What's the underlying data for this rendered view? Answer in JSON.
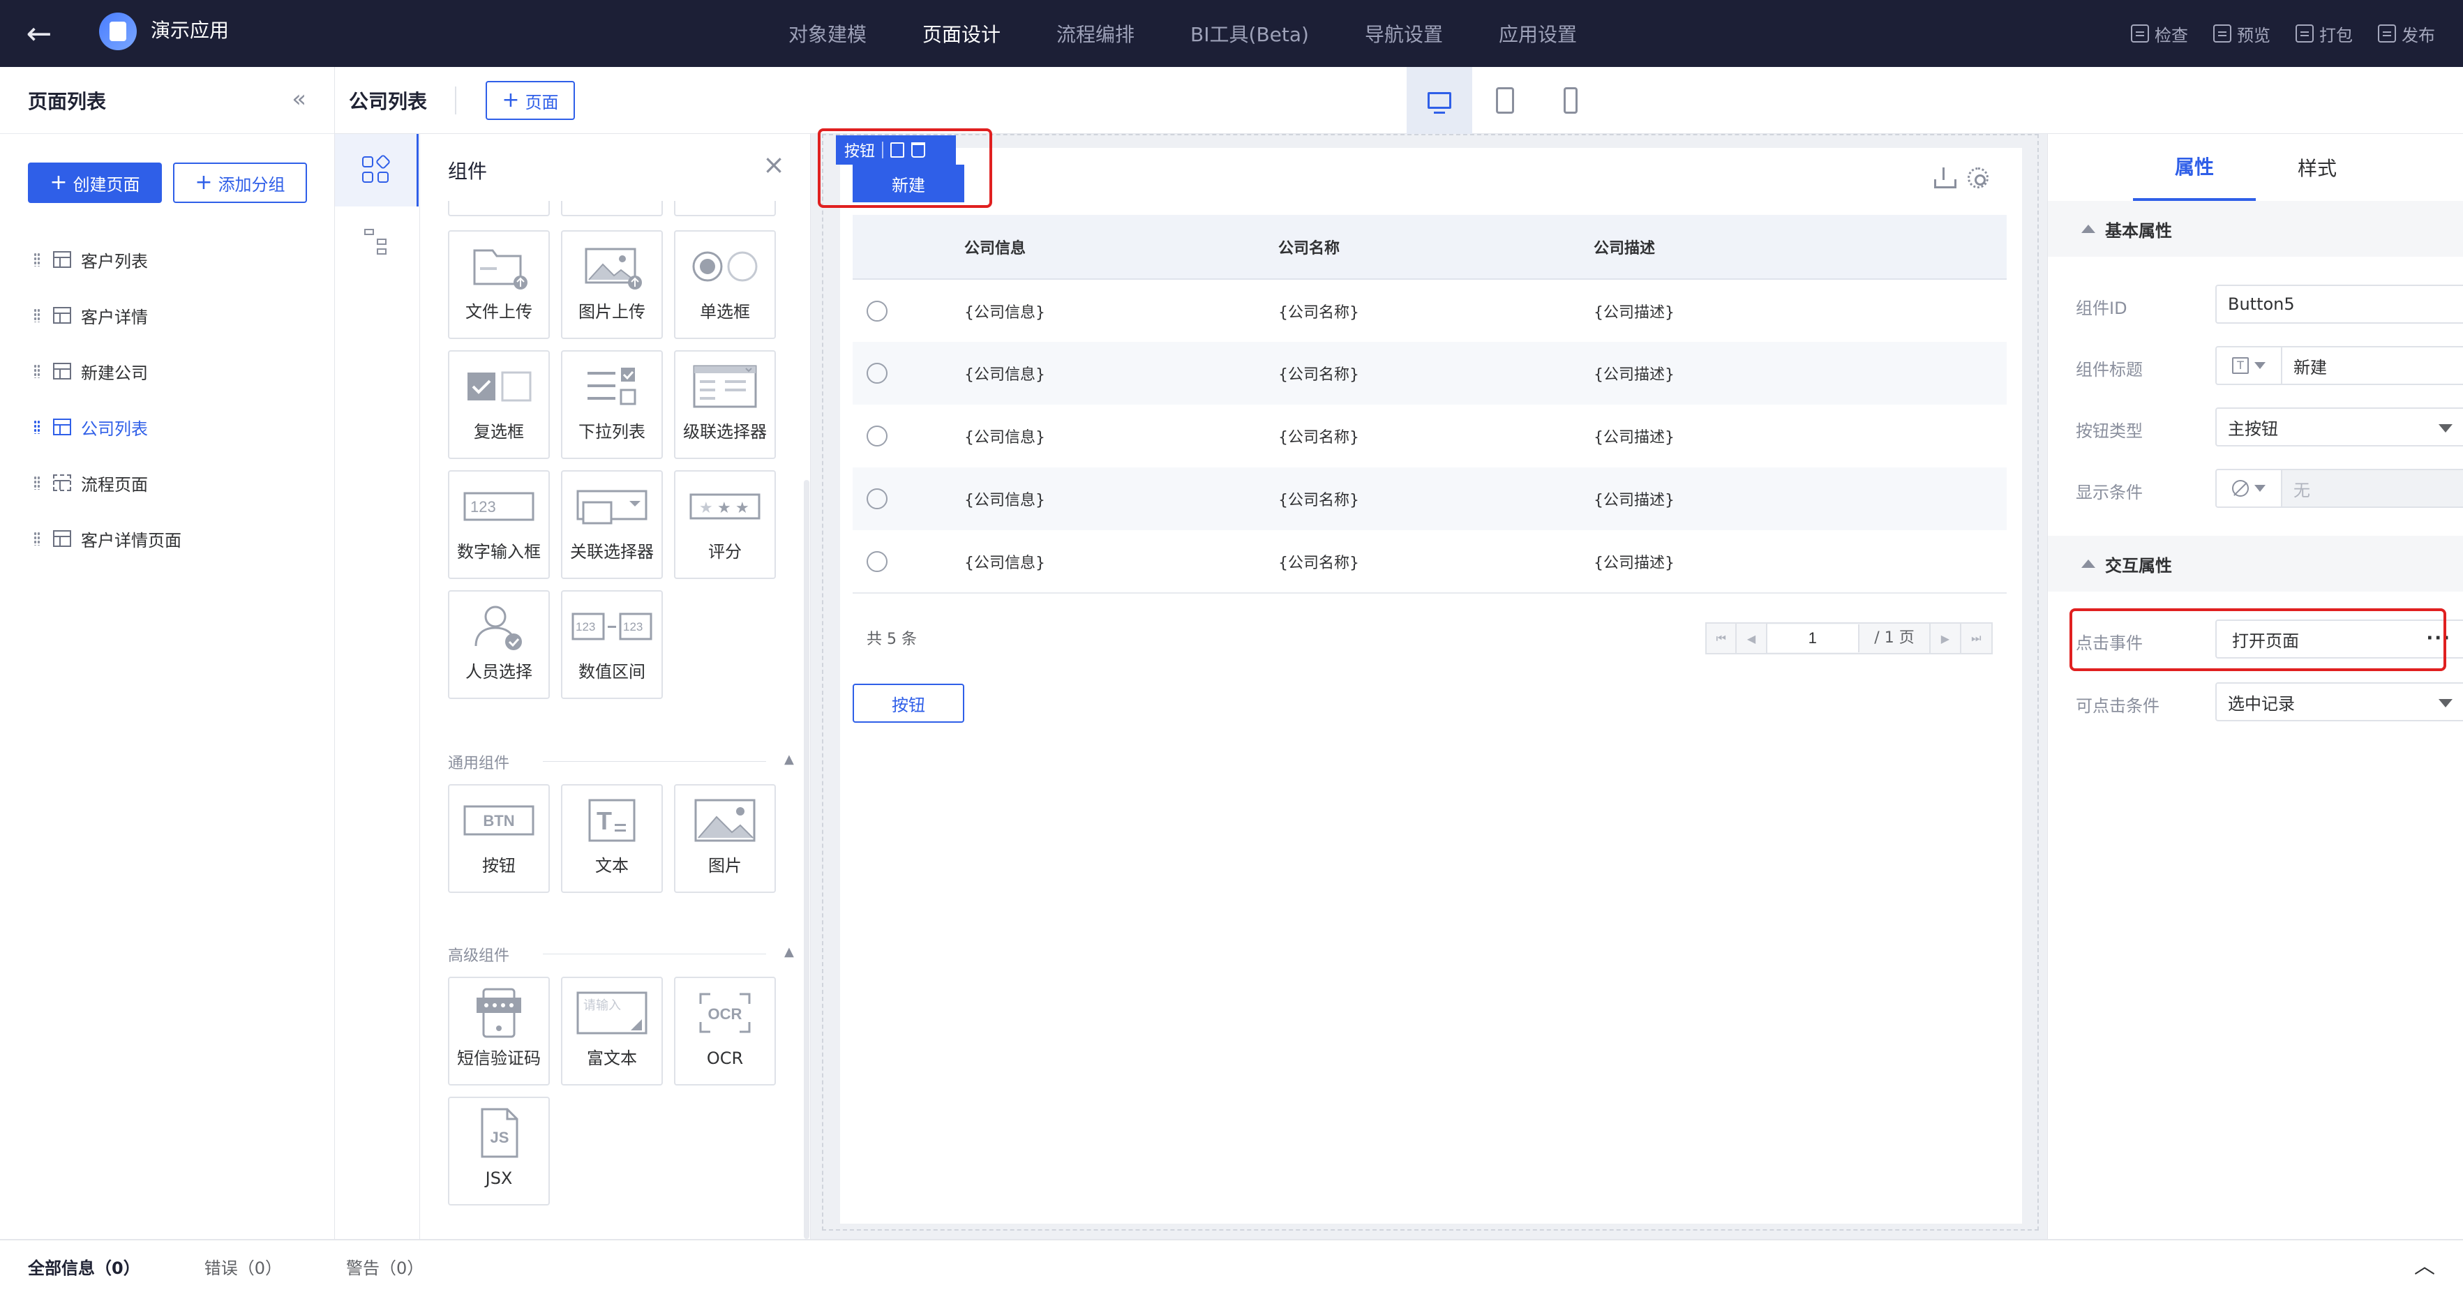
{
  "topbar": {
    "app_name": "演示应用",
    "tabs": [
      {
        "label": "对象建模",
        "active": false
      },
      {
        "label": "页面设计",
        "active": true
      },
      {
        "label": "流程编排",
        "active": false
      },
      {
        "label": "BI工具(Beta)",
        "active": false
      },
      {
        "label": "导航设置",
        "active": false
      },
      {
        "label": "应用设置",
        "active": false
      }
    ],
    "tools": [
      "检查",
      "预览",
      "打包",
      "发布"
    ]
  },
  "pagelist": {
    "title": "页面列表",
    "create_button": "创建页面",
    "add_group_button": "添加分组",
    "pages": [
      {
        "label": "客户列表",
        "active": false,
        "icon": "table-page-icon"
      },
      {
        "label": "客户详情",
        "active": false,
        "icon": "table-page-icon"
      },
      {
        "label": "新建公司",
        "active": false,
        "icon": "table-page-icon"
      },
      {
        "label": "公司列表",
        "active": true,
        "icon": "table-page-icon"
      },
      {
        "label": "流程页面",
        "active": false,
        "icon": "flow-page-icon"
      },
      {
        "label": "客户详情页面",
        "active": false,
        "icon": "table-page-icon"
      }
    ]
  },
  "subheader": {
    "title": "公司列表",
    "add_page_button": "页面",
    "device_active": "desktop"
  },
  "components": {
    "title": "组件",
    "form_items": [
      {
        "label": "文件上传",
        "icon": "file-upload-icon"
      },
      {
        "label": "图片上传",
        "icon": "image-upload-icon"
      },
      {
        "label": "单选框",
        "icon": "radio-icon"
      },
      {
        "label": "复选框",
        "icon": "checkbox-icon"
      },
      {
        "label": "下拉列表",
        "icon": "dropdown-list-icon"
      },
      {
        "label": "级联选择器",
        "icon": "cascader-icon"
      },
      {
        "label": "数字输入框",
        "icon": "number-input-icon"
      },
      {
        "label": "关联选择器",
        "icon": "relation-select-icon"
      },
      {
        "label": "评分",
        "icon": "rating-icon"
      },
      {
        "label": "人员选择",
        "icon": "person-select-icon"
      },
      {
        "label": "数值区间",
        "icon": "number-range-icon"
      }
    ],
    "general_title": "通用组件",
    "general_items": [
      {
        "label": "按钮",
        "icon": "button-icon"
      },
      {
        "label": "文本",
        "icon": "text-icon"
      },
      {
        "label": "图片",
        "icon": "image-icon"
      }
    ],
    "advanced_title": "高级组件",
    "advanced_items": [
      {
        "label": "短信验证码",
        "icon": "sms-code-icon"
      },
      {
        "label": "富文本",
        "icon": "rich-text-icon"
      },
      {
        "label": "OCR",
        "icon": "ocr-icon"
      },
      {
        "label": "JSX",
        "icon": "jsx-icon"
      }
    ],
    "icon_text": {
      "number": "123",
      "btn": "BTN",
      "rich": "请输入",
      "ocr": "OCR",
      "jsx": "JS",
      "text": "T"
    }
  },
  "canvas": {
    "selected_label": "按钮",
    "new_button": "新建",
    "table": {
      "headers": [
        "公司信息",
        "公司名称",
        "公司描述"
      ],
      "rows": [
        [
          "{公司信息}",
          "{公司名称}",
          "{公司描述}"
        ],
        [
          "{公司信息}",
          "{公司名称}",
          "{公司描述}"
        ],
        [
          "{公司信息}",
          "{公司名称}",
          "{公司描述}"
        ],
        [
          "{公司信息}",
          "{公司名称}",
          "{公司描述}"
        ],
        [
          "{公司信息}",
          "{公司名称}",
          "{公司描述}"
        ]
      ]
    },
    "total": "共 5 条",
    "page_input": "1",
    "page_total": "/ 1 页",
    "bottom_button": "按钮"
  },
  "properties": {
    "tabs": [
      {
        "label": "属性",
        "active": true
      },
      {
        "label": "样式",
        "active": false
      }
    ],
    "basic_title": "基本属性",
    "fields": {
      "id_label": "组件ID",
      "id_value": "Button5",
      "title_label": "组件标题",
      "title_value": "新建",
      "type_label": "按钮类型",
      "type_value": "主按钮",
      "show_label": "显示条件",
      "show_value": "无"
    },
    "interaction_title": "交互属性",
    "interaction": {
      "click_label": "点击事件",
      "click_value": "打开页面",
      "clickable_label": "可点击条件",
      "clickable_value": "选中记录"
    }
  },
  "bottombar": {
    "tabs": [
      "全部信息（0）",
      "错误（0）",
      "警告（0）"
    ]
  },
  "colors": {
    "primary": "#2f5fe8",
    "topbar": "#1c1f36",
    "highlight": "#e02020"
  }
}
